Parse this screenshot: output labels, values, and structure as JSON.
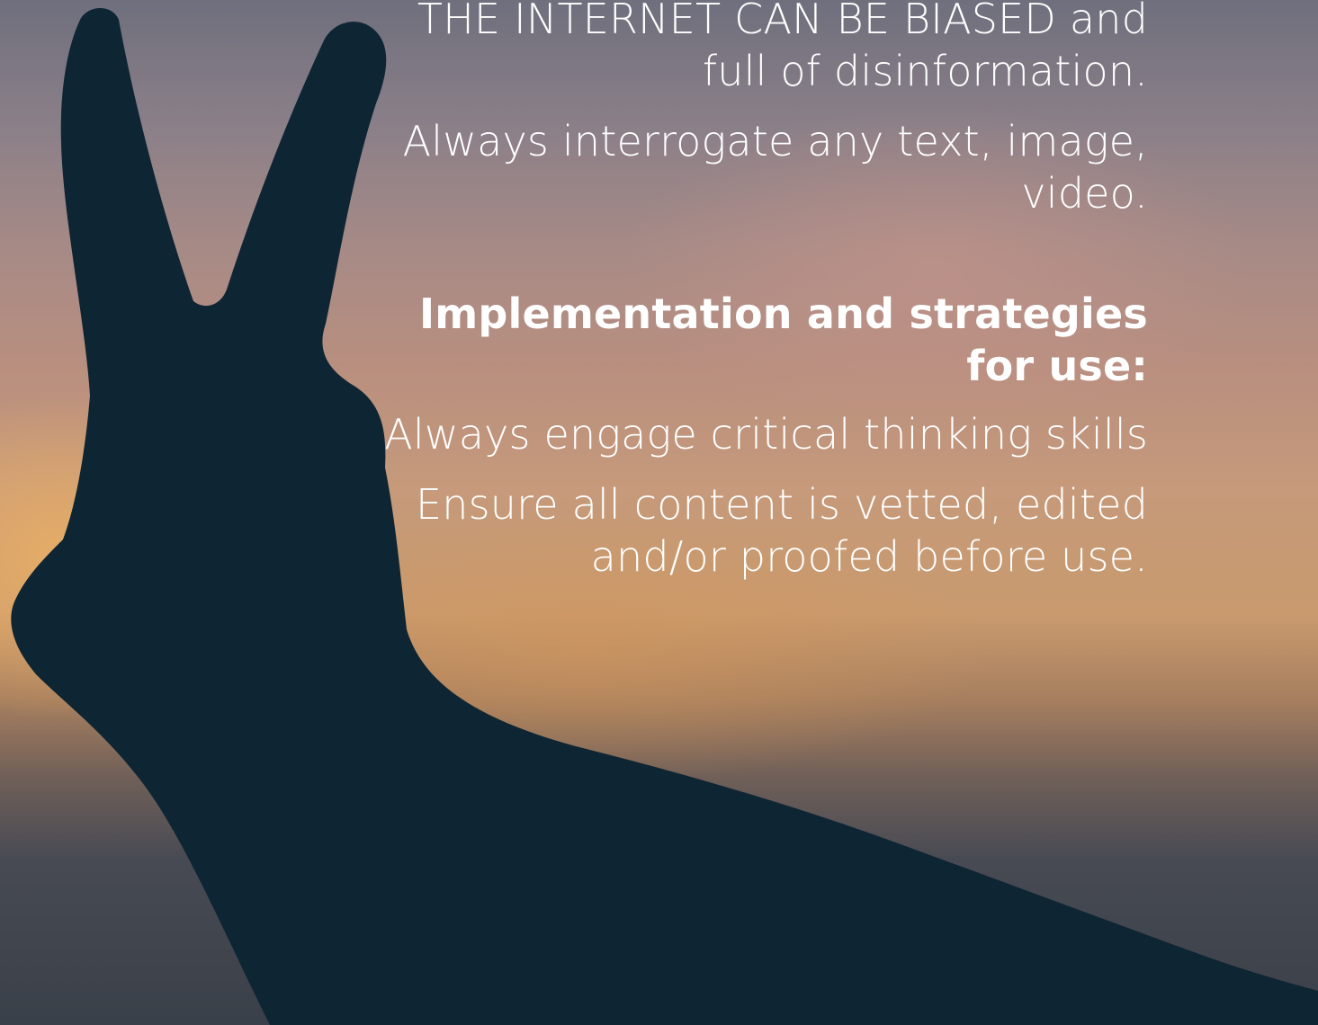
{
  "slide": {
    "line_internet_bias": "THE INTERNET CAN BE BIASED and full of disinformation.",
    "line_interrogate": "Always interrogate any text, image, video.",
    "heading_implementation": "Implementation and strategies for use:",
    "line_critical_thinking": "Always engage critical thinking skills",
    "line_vetted": "Ensure all content is vetted, edited and/or proofed before use."
  },
  "background": {
    "description_icon": "peace-sign-hand-silhouette",
    "sky_top_color": "#6f6f7d",
    "sky_mid_color": "#c69a7a",
    "sky_glow_color": "#ecb064",
    "silhouette_color": "#0e2533"
  }
}
